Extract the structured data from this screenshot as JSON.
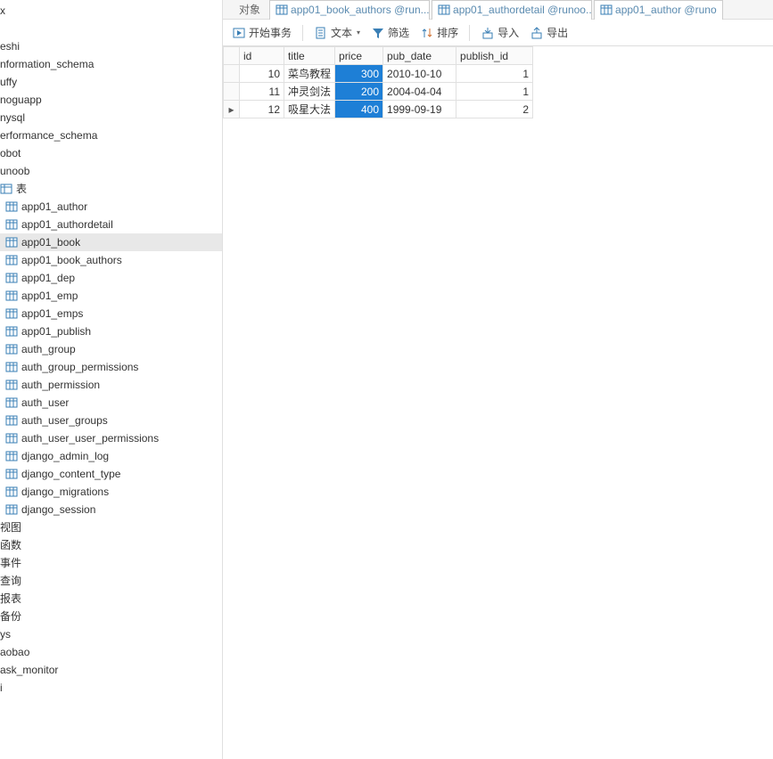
{
  "sidebar": {
    "databases": [
      "x",
      "eshi",
      "nformation_schema",
      "uffy",
      "noguapp",
      "nysql",
      "erformance_schema",
      "obot",
      "unoob"
    ],
    "tables_node": "表",
    "tables": [
      "app01_author",
      "app01_authordetail",
      "app01_book",
      "app01_book_authors",
      "app01_dep",
      "app01_emp",
      "app01_emps",
      "app01_publish",
      "auth_group",
      "auth_group_permissions",
      "auth_permission",
      "auth_user",
      "auth_user_groups",
      "auth_user_user_permissions",
      "django_admin_log",
      "django_content_type",
      "django_migrations",
      "django_session"
    ],
    "selected_table": "app01_book",
    "other_nodes": [
      "视图",
      "函数",
      "事件",
      "查询",
      "报表",
      "备份"
    ],
    "trailing": [
      "ys",
      "aobao",
      "ask_monitor",
      "i"
    ]
  },
  "tabs": {
    "object": "对象",
    "items": [
      "app01_book_authors @run...",
      "app01_authordetail @runoo...",
      "app01_author @runo"
    ]
  },
  "toolbar": {
    "begin": "开始事务",
    "text": "文本",
    "filter": "筛选",
    "sort": "排序",
    "import": "导入",
    "export": "导出"
  },
  "grid": {
    "columns": [
      "id",
      "title",
      "price",
      "pub_date",
      "publish_id"
    ],
    "selected_column": "price",
    "current_row_index": 2,
    "rows": [
      {
        "id": "10",
        "title": "菜鸟教程",
        "price": "300",
        "pub_date": "2010-10-10",
        "publish_id": "1"
      },
      {
        "id": "11",
        "title": "冲灵剑法",
        "price": "200",
        "pub_date": "2004-04-04",
        "publish_id": "1"
      },
      {
        "id": "12",
        "title": "吸星大法",
        "price": "400",
        "pub_date": "1999-09-19",
        "publish_id": "2"
      }
    ]
  },
  "icons": {
    "row_marker": "▸"
  }
}
